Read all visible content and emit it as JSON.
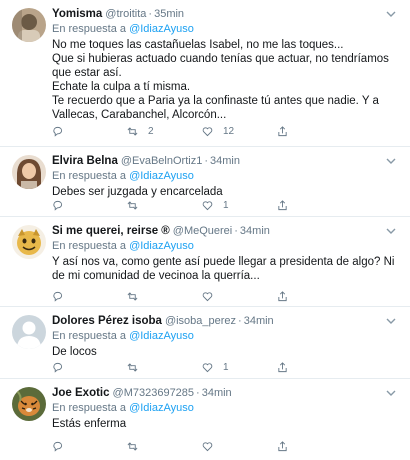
{
  "reply_prefix": "En respuesta a",
  "tweets": [
    {
      "name": "Yomisma",
      "handle": "@troitita",
      "time": "35min",
      "mention": "@IdiazAyuso",
      "lines": [
        "No me toques las castañuelas Isabel, no me las toques...",
        "Que si hubieras actuado cuando tenías que actuar, no tendríamos que estar así.",
        "Echate la culpa a tí misma.",
        "Te recuerdo que a Paria ya la confinaste tú antes que nadie. Y a Vallecas, Carabanchel, Alcorcón..."
      ],
      "replies": "",
      "retweets": "2",
      "likes": "12"
    },
    {
      "name": "Elvira Belna",
      "handle": "@EvaBelnOrtiz1",
      "time": "34min",
      "mention": "@IdiazAyuso",
      "lines": [
        "Debes ser juzgada y encarcelada"
      ],
      "replies": "",
      "retweets": "",
      "likes": "1"
    },
    {
      "name": "Si me querei, reirse ®",
      "handle": "@MeQuerei",
      "time": "34min",
      "mention": "@IdiazAyuso",
      "lines": [
        "Y así nos va, como gente así puede llegar a presidenta de algo? Ni de mi comunidad de vecinoa la querría..."
      ],
      "replies": "",
      "retweets": "",
      "likes": ""
    },
    {
      "name": "Dolores Pérez isoba",
      "handle": "@isoba_perez",
      "time": "34min",
      "mention": "@IdiazAyuso",
      "lines": [
        "De locos"
      ],
      "replies": "",
      "retweets": "",
      "likes": "1"
    },
    {
      "name": "Joe Exotic",
      "handle": "@M7323697285",
      "time": "34min",
      "mention": "@IdiazAyuso",
      "lines": [
        "Estás enferma"
      ],
      "replies": "",
      "retweets": "",
      "likes": ""
    }
  ]
}
